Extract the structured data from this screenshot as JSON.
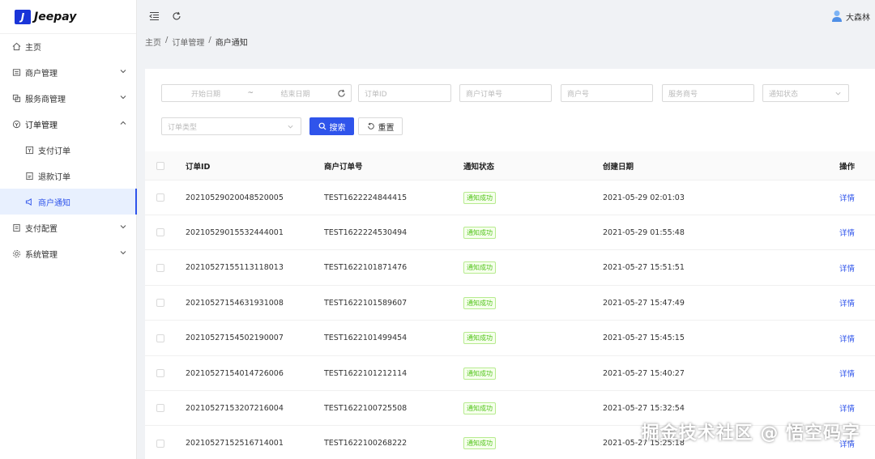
{
  "app": {
    "logo_mark": "J",
    "logo_text": "Jeepay"
  },
  "sidebar": {
    "items": [
      {
        "label": "主页",
        "icon": "home-icon"
      },
      {
        "label": "商户管理",
        "icon": "shop-icon"
      },
      {
        "label": "服务商管理",
        "icon": "provider-icon"
      },
      {
        "label": "订单管理",
        "icon": "order-icon"
      },
      {
        "label": "支付订单",
        "icon": "pay-order-icon"
      },
      {
        "label": "退款订单",
        "icon": "refund-icon"
      },
      {
        "label": "商户通知",
        "icon": "notify-icon"
      },
      {
        "label": "支付配置",
        "icon": "pay-config-icon"
      },
      {
        "label": "系统管理",
        "icon": "settings-icon"
      }
    ]
  },
  "header": {
    "user_name": "大森林"
  },
  "breadcrumb": {
    "home": "主页",
    "sep": "/",
    "section": "订单管理",
    "current": "商户通知"
  },
  "filters": {
    "start_date": "开始日期",
    "range_sep": "~",
    "end_date": "结束日期",
    "order_id": "订单ID",
    "mch_order_no": "商户订单号",
    "mch_no": "商户号",
    "isv_no": "服务商号",
    "notify_state": "通知状态",
    "order_type": "订单类型",
    "search_label": "搜索",
    "reset_label": "重置"
  },
  "table": {
    "columns": [
      "订单ID",
      "商户订单号",
      "通知状态",
      "创建日期",
      "操作"
    ],
    "rows": [
      {
        "order_id": "20210529020048520005",
        "mch_order_no": "TEST1622224844415",
        "state": "通知成功",
        "created": "2021-05-29 02:01:03",
        "op": "详情"
      },
      {
        "order_id": "20210529015532444001",
        "mch_order_no": "TEST1622224530494",
        "state": "通知成功",
        "created": "2021-05-29 01:55:48",
        "op": "详情"
      },
      {
        "order_id": "20210527155113118013",
        "mch_order_no": "TEST1622101871476",
        "state": "通知成功",
        "created": "2021-05-27 15:51:51",
        "op": "详情"
      },
      {
        "order_id": "20210527154631931008",
        "mch_order_no": "TEST1622101589607",
        "state": "通知成功",
        "created": "2021-05-27 15:47:49",
        "op": "详情"
      },
      {
        "order_id": "20210527154502190007",
        "mch_order_no": "TEST1622101499454",
        "state": "通知成功",
        "created": "2021-05-27 15:45:15",
        "op": "详情"
      },
      {
        "order_id": "20210527154014726006",
        "mch_order_no": "TEST1622101212114",
        "state": "通知成功",
        "created": "2021-05-27 15:40:27",
        "op": "详情"
      },
      {
        "order_id": "20210527153207216004",
        "mch_order_no": "TEST1622100725508",
        "state": "通知成功",
        "created": "2021-05-27 15:32:54",
        "op": "详情"
      },
      {
        "order_id": "20210527152516714001",
        "mch_order_no": "TEST1622100268222",
        "state": "通知成功",
        "created": "2021-05-27 15:25:18",
        "op": "详情"
      }
    ]
  },
  "watermark": "掘金技术社区 @ 悟空码字",
  "colors": {
    "primary": "#2f54eb",
    "success": "#52c41a",
    "logo": "#1a35d8"
  }
}
